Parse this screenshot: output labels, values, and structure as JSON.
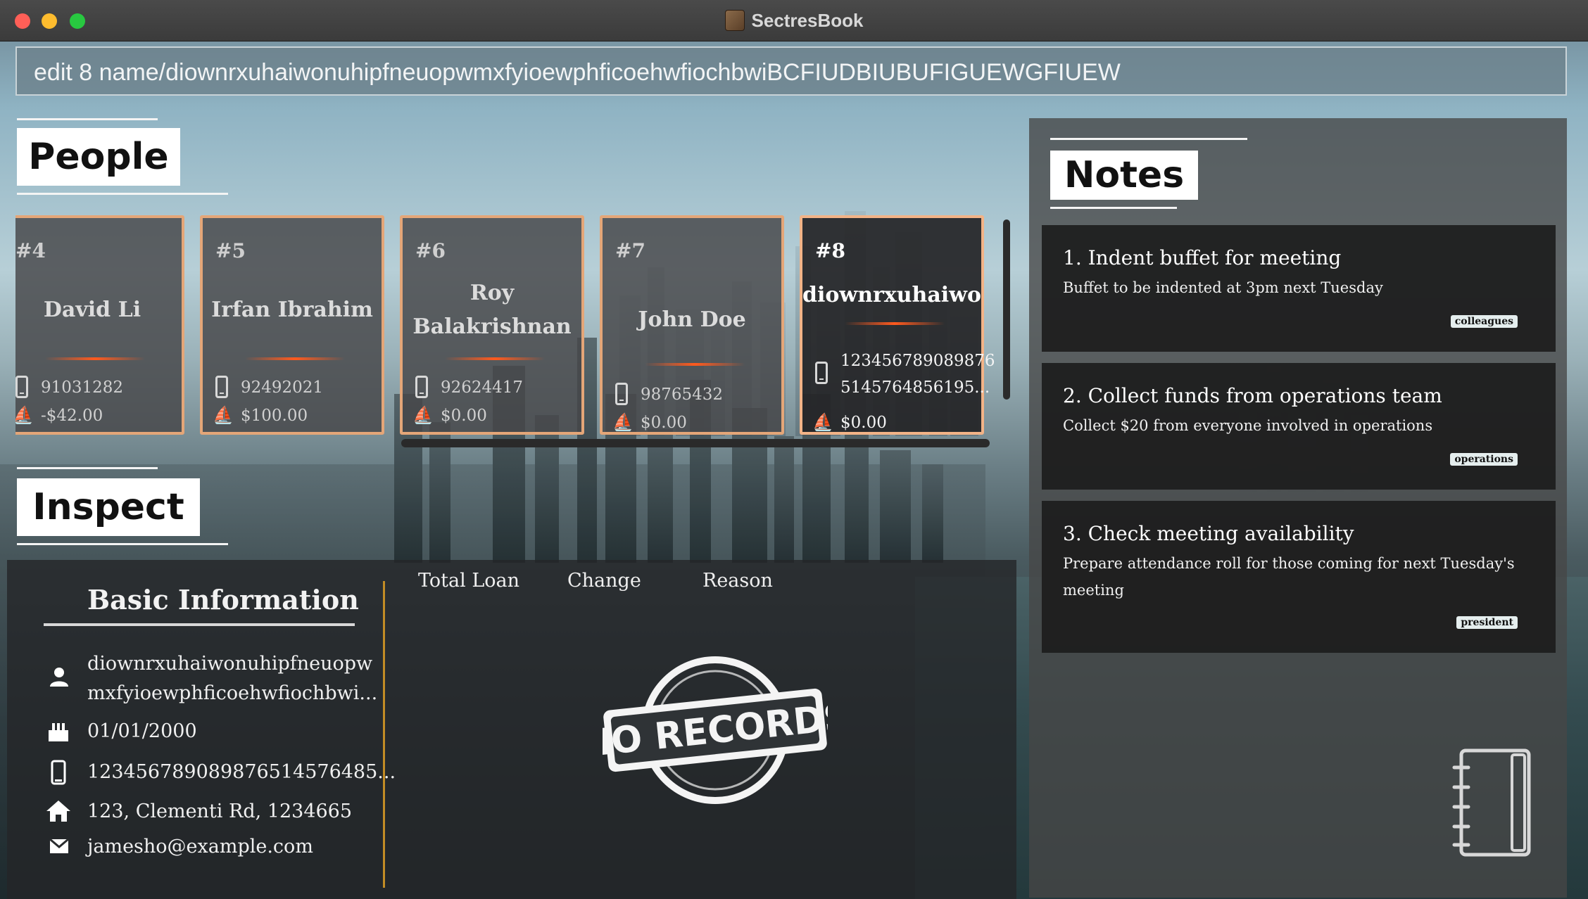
{
  "window": {
    "title": "SectresBook"
  },
  "command": {
    "value": "edit 8 name/diownrxuhaiwonuhipfneuopwmxfyioewphficoehwfiochbwiBCFIUDBIUBUFIGUEWGFIUEW"
  },
  "people": {
    "heading": "People",
    "cards": [
      {
        "index": "#4",
        "name": "David Li",
        "phone": "91031282",
        "loan": "-$42.00"
      },
      {
        "index": "#5",
        "name": "Irfan Ibrahim",
        "phone": "92492021",
        "loan": "$100.00"
      },
      {
        "index": "#6",
        "name": "Roy Balakrishnan",
        "phone": "92624417",
        "loan": "$0.00"
      },
      {
        "index": "#7",
        "name": "John Doe",
        "phone": "98765432",
        "loan": "$0.00"
      },
      {
        "index": "#8",
        "name": "diownrxuhaiwo",
        "phone_line1": "123456789089876",
        "phone_line2": "5145764856195...",
        "loan": "$0.00",
        "selected": true
      }
    ]
  },
  "notes": {
    "heading": "Notes",
    "items": [
      {
        "title": "1.  Indent buffet for meeting",
        "body": "Buffet to be indented at 3pm next Tuesday",
        "tag": "colleagues"
      },
      {
        "title": "2.  Collect funds from operations team",
        "body": "Collect $20 from everyone involved in operations",
        "tag": "operations"
      },
      {
        "title": "3.  Check meeting availability",
        "body": "Prepare attendance roll for those coming for next Tuesday's meeting",
        "tag": "president"
      }
    ]
  },
  "inspect": {
    "heading": "Inspect",
    "basic_info_title": "Basic Information",
    "name_line1": "diownrxuhaiwonuhipfneuopw",
    "name_line2": "mxfyioewphficoehwfiochbwi...",
    "birthday": "01/01/2000",
    "phone": "12345678908987651457648​5...",
    "address": "123, Clementi Rd, 1234665",
    "email": "jamesho@example.com",
    "columns": [
      "Total Loan",
      "Change",
      "Reason"
    ],
    "empty_stamp": "NO RECORDS"
  },
  "icons": {
    "person": "person-icon",
    "birthday": "cake-icon",
    "phone": "phone-icon",
    "address": "home-icon",
    "email": "mail-icon",
    "loan": "hand-money-icon",
    "notebook": "notebook-icon"
  },
  "colors": {
    "card_border": "#e4a678",
    "accent_rule": "#ff5a1e",
    "divider": "#c28c25"
  }
}
